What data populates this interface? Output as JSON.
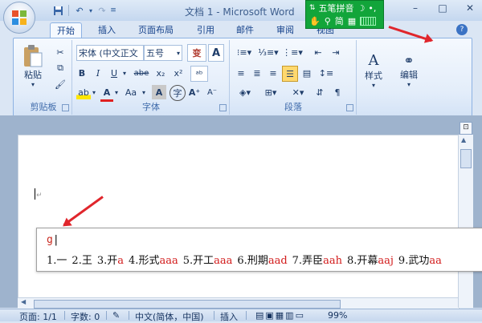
{
  "window": {
    "title": "文档 1 - Microsoft Word",
    "controls": [
      "–",
      "□",
      "✕"
    ]
  },
  "quick_access": {
    "icons": [
      "save-icon",
      "undo-icon",
      "redo-icon",
      "customize-icon"
    ]
  },
  "ime": {
    "name": "五笔拼音",
    "mode": "简",
    "icons": [
      "ime-arrows-icon",
      "moon-icon",
      "punctuation-icon",
      "hand-icon",
      "search-icon",
      "skin-icon",
      "keyboard-icon"
    ],
    "color": "#12a53a"
  },
  "tabs": [
    "开始",
    "插入",
    "页面布局",
    "引用",
    "邮件",
    "审阅",
    "视图"
  ],
  "active_tab": "开始",
  "ribbon": {
    "clipboard": {
      "label": "剪贴板",
      "paste": "粘贴",
      "paste_arrow": "▾"
    },
    "font": {
      "label": "字体",
      "font_name": "宋体 (中文正文",
      "font_size": "五号",
      "wen_button": "变",
      "bold": "B",
      "italic": "I",
      "underline": "U",
      "strike": "abe",
      "subscript": "x₂",
      "superscript": "x²",
      "change_case": "Aa",
      "highlight": "ab",
      "font_color": "A",
      "char_shading": "A",
      "enclose": "字"
    },
    "paragraph": {
      "label": "段落"
    },
    "styles": {
      "label": "样式",
      "arrow": "▾"
    },
    "editing": {
      "label": "编辑",
      "arrow": "▾"
    }
  },
  "candidates": {
    "input": "g",
    "items": [
      {
        "num": "1.",
        "text": "一",
        "code": ""
      },
      {
        "num": "2.",
        "text": "王",
        "code": ""
      },
      {
        "num": "3.",
        "text": "开",
        "code": "a"
      },
      {
        "num": "4.",
        "text": "形式",
        "code": "aaa"
      },
      {
        "num": "5.",
        "text": "开工",
        "code": "aaa"
      },
      {
        "num": "6.",
        "text": "刑期",
        "code": "aad"
      },
      {
        "num": "7.",
        "text": "弄臣",
        "code": "aah"
      },
      {
        "num": "8.",
        "text": "开幕",
        "code": "aaj"
      },
      {
        "num": "9.",
        "text": "武功",
        "code": "aa"
      }
    ]
  },
  "status": {
    "page": "页面: 1/1",
    "words": "字数: 0",
    "language": "中文(简体，中国)",
    "mode": "插入",
    "zoom": "99%"
  },
  "colors": {
    "accent": "#15428b",
    "annotation": "#e0262c",
    "candidate_code": "#d21a1a"
  }
}
